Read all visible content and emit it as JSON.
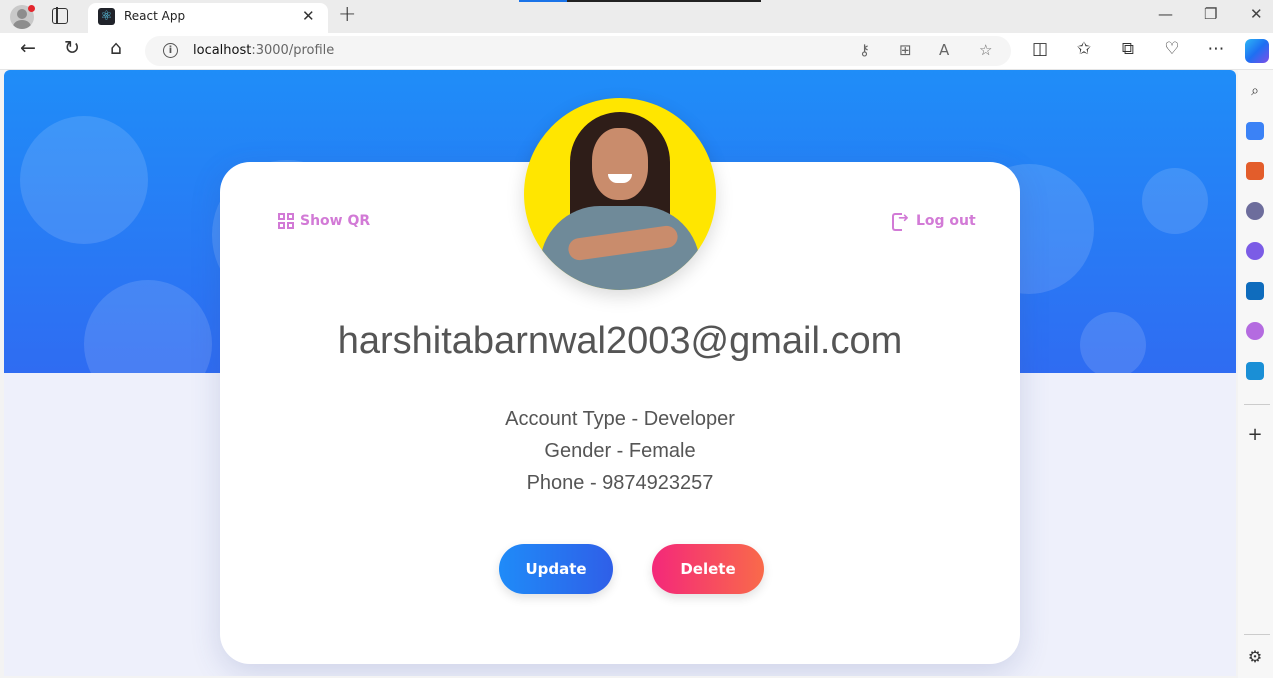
{
  "browser": {
    "tab_title": "React App",
    "tab_close": "✕",
    "new_tab": "+",
    "address_host": "localhost",
    "address_path": ":3000/profile",
    "window_controls": [
      "—",
      "❐",
      "✕"
    ]
  },
  "profile": {
    "show_qr": "Show QR",
    "logout": "Log out",
    "email": "harshitabarnwal2003@gmail.com",
    "account_type": "Account Type - Developer",
    "gender": "Gender - Female",
    "phone": "Phone - 9874923257",
    "update_label": "Update",
    "delete_label": "Delete"
  },
  "colors": {
    "hero_start": "#1f8df8",
    "hero_end": "#2f6cf2",
    "link": "#d27ad6",
    "update": "#1f8bf8",
    "delete": "#f4287a",
    "avatar_bg": "#ffe600"
  }
}
